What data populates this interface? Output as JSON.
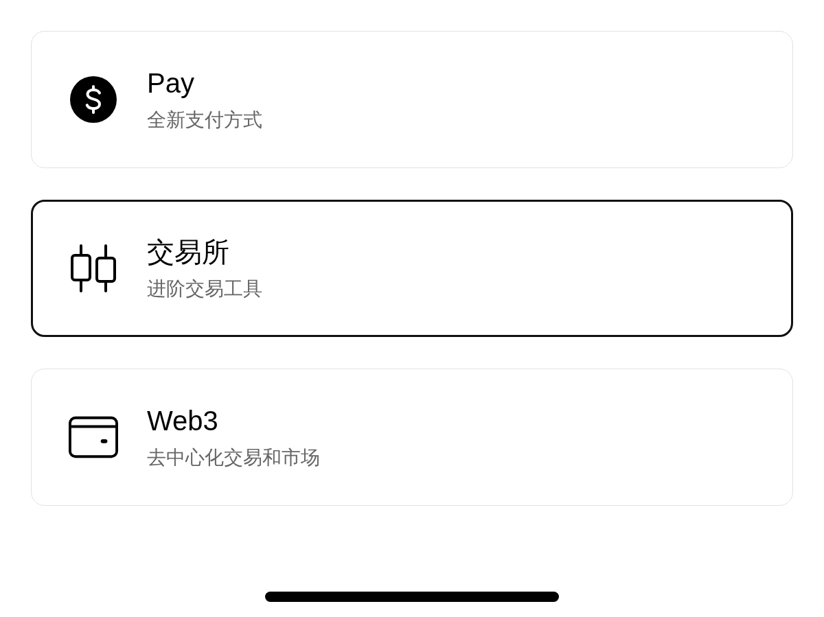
{
  "options": [
    {
      "title": "Pay",
      "subtitle": "全新支付方式",
      "selected": false
    },
    {
      "title": "交易所",
      "subtitle": "进阶交易工具",
      "selected": true
    },
    {
      "title": "Web3",
      "subtitle": "去中心化交易和市场",
      "selected": false
    }
  ]
}
